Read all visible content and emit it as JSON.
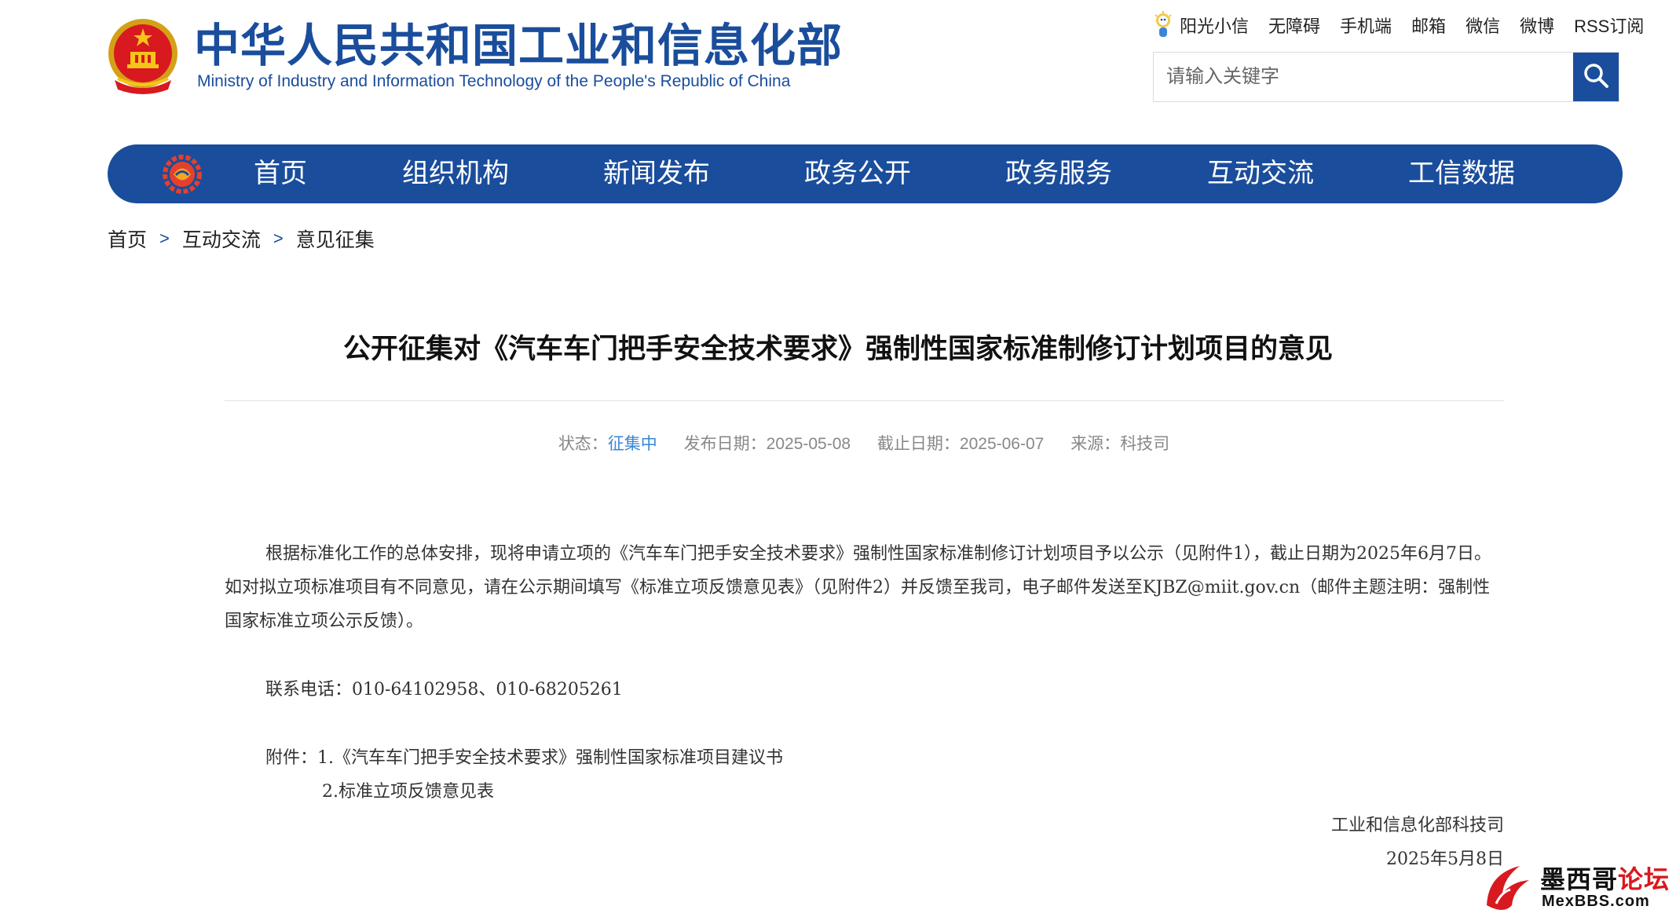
{
  "header": {
    "site_name_cn": "中华人民共和国工业和信息化部",
    "site_name_en": "Ministry of Industry and Information Technology of the People's Republic of China",
    "toplinks": [
      {
        "label": "阳光小信",
        "icon": "sun-mascot-icon"
      },
      {
        "label": "无障碍"
      },
      {
        "label": "手机端"
      },
      {
        "label": "邮箱"
      },
      {
        "label": "微信"
      },
      {
        "label": "微博"
      },
      {
        "label": "RSS订阅"
      }
    ],
    "search": {
      "placeholder": "请输入关键字",
      "value": "",
      "icon": "search-icon"
    }
  },
  "nav": {
    "logo_icon": "gear-logo-icon",
    "items": [
      {
        "label": "首页"
      },
      {
        "label": "组织机构"
      },
      {
        "label": "新闻发布"
      },
      {
        "label": "政务公开"
      },
      {
        "label": "政务服务"
      },
      {
        "label": "互动交流"
      },
      {
        "label": "工信数据"
      }
    ]
  },
  "breadcrumb": {
    "items": [
      "首页",
      "互动交流",
      "意见征集"
    ],
    "separator": ">"
  },
  "article": {
    "title": "公开征集对《汽车车门把手安全技术要求》强制性国家标准制修订计划项目的意见",
    "meta": {
      "status_label": "状态：",
      "status_value": "征集中",
      "publish_label": "发布日期：",
      "publish_value": "2025-05-08",
      "deadline_label": "截止日期：",
      "deadline_value": "2025-06-07",
      "source_label": "来源：",
      "source_value": "科技司"
    },
    "paragraph1": "根据标准化工作的总体安排，现将申请立项的《汽车车门把手安全技术要求》强制性国家标准制修订计划项目予以公示（见附件1），截止日期为2025年6月7日。如对拟立项标准项目有不同意见，请在公示期间填写《标准立项反馈意见表》（见附件2）并反馈至我司，电子邮件发送至KJBZ@miit.gov.cn（邮件主题注明：强制性国家标准立项公示反馈）。",
    "contact": "联系电话：010-64102958、010-68205261",
    "attachment_label": "附件：",
    "attachments": [
      "1.《汽车车门把手安全技术要求》强制性国家标准项目建议书",
      "2.标准立项反馈意见表"
    ],
    "signature_org": "工业和信息化部科技司",
    "signature_date": "2025年5月8日"
  },
  "watermark": {
    "text_black": "墨西哥",
    "text_red": "论坛",
    "sub": "MexBBS.com"
  },
  "colors": {
    "brand_blue": "#1a4d9c",
    "status_blue": "#3a86d6",
    "watermark_red": "#d8191f"
  }
}
